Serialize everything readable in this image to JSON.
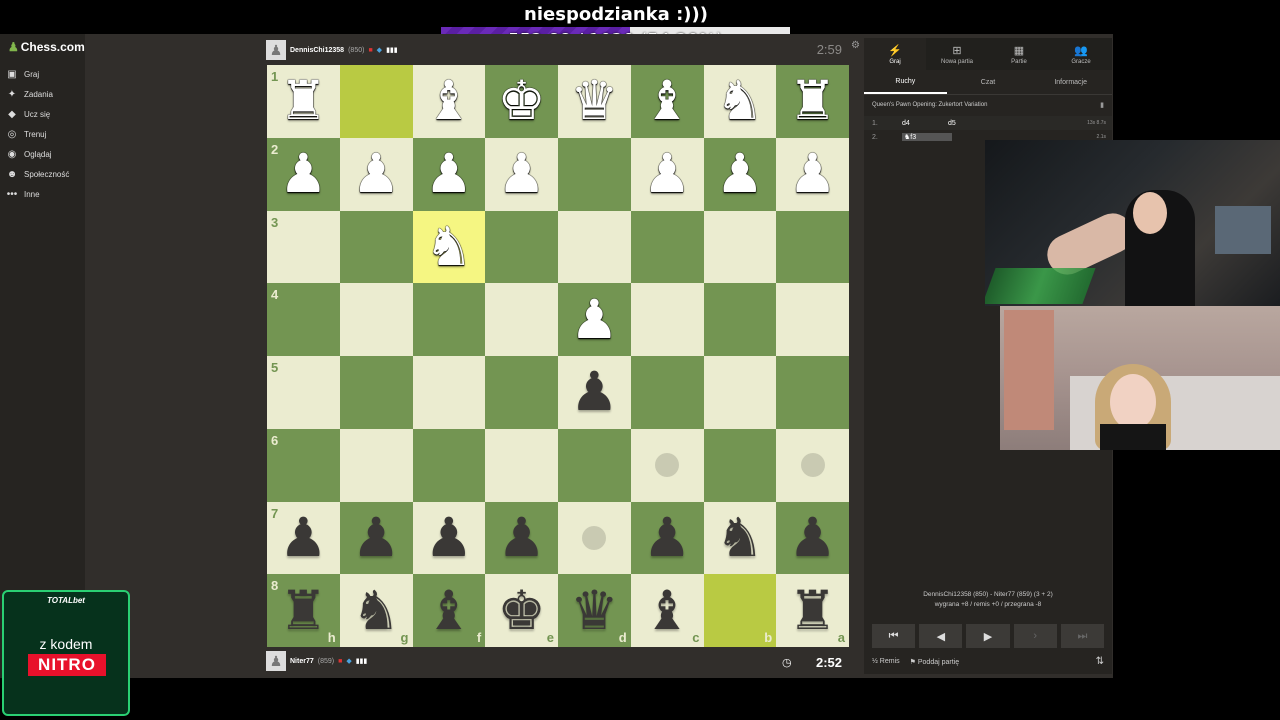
{
  "overlay": {
    "goal_title": "niespodzianka :)))",
    "goal_progress": "552.88 / 1020 (54.20%)",
    "goal_fraction": 0.542
  },
  "sidebar": {
    "logo": "Chess.com",
    "items": [
      {
        "label": "Graj",
        "icon": "play-icon"
      },
      {
        "label": "Zadania",
        "icon": "puzzle-icon"
      },
      {
        "label": "Ucz się",
        "icon": "learn-icon"
      },
      {
        "label": "Trenuj",
        "icon": "train-icon"
      },
      {
        "label": "Oglądaj",
        "icon": "watch-icon"
      },
      {
        "label": "Społeczność",
        "icon": "community-icon"
      },
      {
        "label": "Inne",
        "icon": "more-icon"
      }
    ]
  },
  "top_player": {
    "name": "DennisChi12358",
    "rating": "(850)",
    "clock": "2:59"
  },
  "bottom_player": {
    "name": "Niter77",
    "rating": "(859)",
    "clock": "2:52"
  },
  "board": {
    "ranks": [
      "1",
      "2",
      "3",
      "4",
      "5",
      "6",
      "7",
      "8"
    ],
    "files": [
      "h",
      "g",
      "f",
      "e",
      "d",
      "c",
      "b",
      "a"
    ],
    "rows": [
      [
        "wR",
        "",
        "wB",
        "wK",
        "wQ",
        "wB",
        "wN",
        "wR"
      ],
      [
        "wP",
        "wP",
        "wP",
        "wP",
        "",
        "wP",
        "wP",
        "wP"
      ],
      [
        "",
        "",
        "wN",
        "",
        "",
        "",
        "",
        ""
      ],
      [
        "",
        "",
        "",
        "",
        "wP",
        "",
        "",
        ""
      ],
      [
        "",
        "",
        "",
        "",
        "bP",
        "",
        "",
        ""
      ],
      [
        "",
        "",
        "",
        "",
        "",
        "dot",
        "",
        "dot"
      ],
      [
        "bP",
        "bP",
        "bP",
        "bP",
        "dot",
        "bP",
        "bN",
        "bP"
      ],
      [
        "bR",
        "bN",
        "bB",
        "bK",
        "bQ",
        "bB",
        "",
        "bR"
      ]
    ],
    "highlights": [
      "0-1",
      "2-2",
      "7-6"
    ]
  },
  "panel": {
    "tabs": [
      {
        "label": "Graj",
        "icon": "bolt-icon"
      },
      {
        "label": "Nowa partia",
        "icon": "plus-icon"
      },
      {
        "label": "Partie",
        "icon": "board-icon"
      },
      {
        "label": "Gracze",
        "icon": "players-icon"
      }
    ],
    "sub_tabs": [
      "Ruchy",
      "Czat",
      "Informacje"
    ],
    "opening": "Queen's Pawn Opening: Zukertort Variation",
    "moves": [
      {
        "num": "1.",
        "white": "d4",
        "black": "d5",
        "time": "13s 8.7s"
      },
      {
        "num": "2.",
        "white": "♞f3",
        "black": "",
        "time": "2.1s"
      }
    ],
    "game_info_line1": "DennisChi12358 (850) - Niter77 (859) (3 + 2)",
    "game_info_line2": "wygrana +8 / remis +0 / przegrana -8",
    "draw_label": "Remis",
    "draw_icon": "½",
    "resign_label": "Poddaj partię"
  },
  "promo": {
    "brand": "TOTALbet",
    "text": "z kodem",
    "code": "NITRO"
  }
}
